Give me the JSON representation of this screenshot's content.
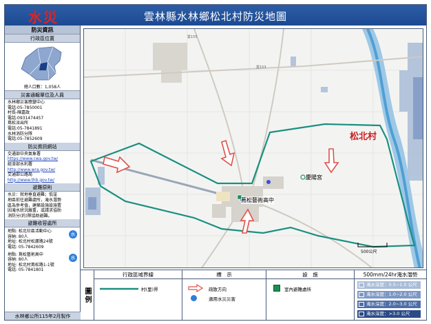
{
  "header": {
    "badge": "水災",
    "title": "雲林縣水林鄉松北村防災地圖"
  },
  "sidebar": {
    "heading": "防災資訊",
    "location_title": "行政區位置",
    "population": "總人口數：1,058人",
    "contacts_title": "災害通報單位及人員",
    "contacts": [
      "水林鄉災害應變中心",
      "電話:05-7850001",
      "村長-陳嘉政",
      "電話:0931474457",
      "蔦松派出所",
      "電話:05-7841891",
      "水林消防分隊",
      "電話:05-7852609"
    ],
    "websites_title": "防災資訊網站",
    "websites": [
      {
        "label": "交通部中央氣象署",
        "url": "https://www.cwa.gov.tw/"
      },
      {
        "label": "經濟部水利署",
        "url": "http://www.wra.gov.tw/"
      },
      {
        "label": "交通部公路局",
        "url": "http://www.thb.gov.tw/"
      }
    ],
    "principle_title": "避難原則",
    "principle_text": [
      "水災：就地垂直避難；低窪",
      "地區前往避難處所，淹水潛勢",
      "區為參考值，建築設施設施置",
      "因淹水狀況嚴重，或請求協助",
      "消防分(的)隊協助避難。"
    ],
    "shelters_title": "避難收容處所",
    "shelters": [
      {
        "lines": [
          "地點: 松北社區活動中心",
          "容納: 80人",
          "地址: 松北村松蘆路24號",
          "電話: 05-7842609"
        ],
        "icon": "水"
      },
      {
        "lines": [
          "地點: 蔦松藝術高中",
          "容納: 80人",
          "地址: 松北村蔦松路1-1號",
          "電話: 05-7841801"
        ],
        "icon": "水"
      }
    ],
    "footer": "水林鄉公所115年2月製作"
  },
  "map": {
    "village_label": "松北村",
    "school_label": "蔦松藝術高中",
    "temple_label": "慶陽宮",
    "road_label_1": "雲153",
    "road_label_2": "雲155",
    "scale_label": "500公尺",
    "colors": {
      "boundary": "#1a8f80",
      "arrow": "#e0504a",
      "river": "#4f9fd4"
    }
  },
  "legend": {
    "label": "圖例",
    "col1_title": "行政區域界線",
    "boundary_item": "村(里)界",
    "col2_title": "標　示",
    "evac_item": "疏散方向",
    "shelter_item": "適用水災災害",
    "col3_title": "設　施",
    "facility_item": "室內避難處所",
    "col4_title": "500mm/24hr淹水潛勢",
    "flood": [
      {
        "label": "淹水深度：0.5~1.0 公尺",
        "color": "#a8bcd8"
      },
      {
        "label": "淹水深度：1.0~2.0 公尺",
        "color": "#7d97c4"
      },
      {
        "label": "淹水深度：2.0~3.0 公尺",
        "color": "#4f6ea8"
      },
      {
        "label": "淹水深度：>3.0 公尺",
        "color": "#2b4a86"
      }
    ]
  }
}
